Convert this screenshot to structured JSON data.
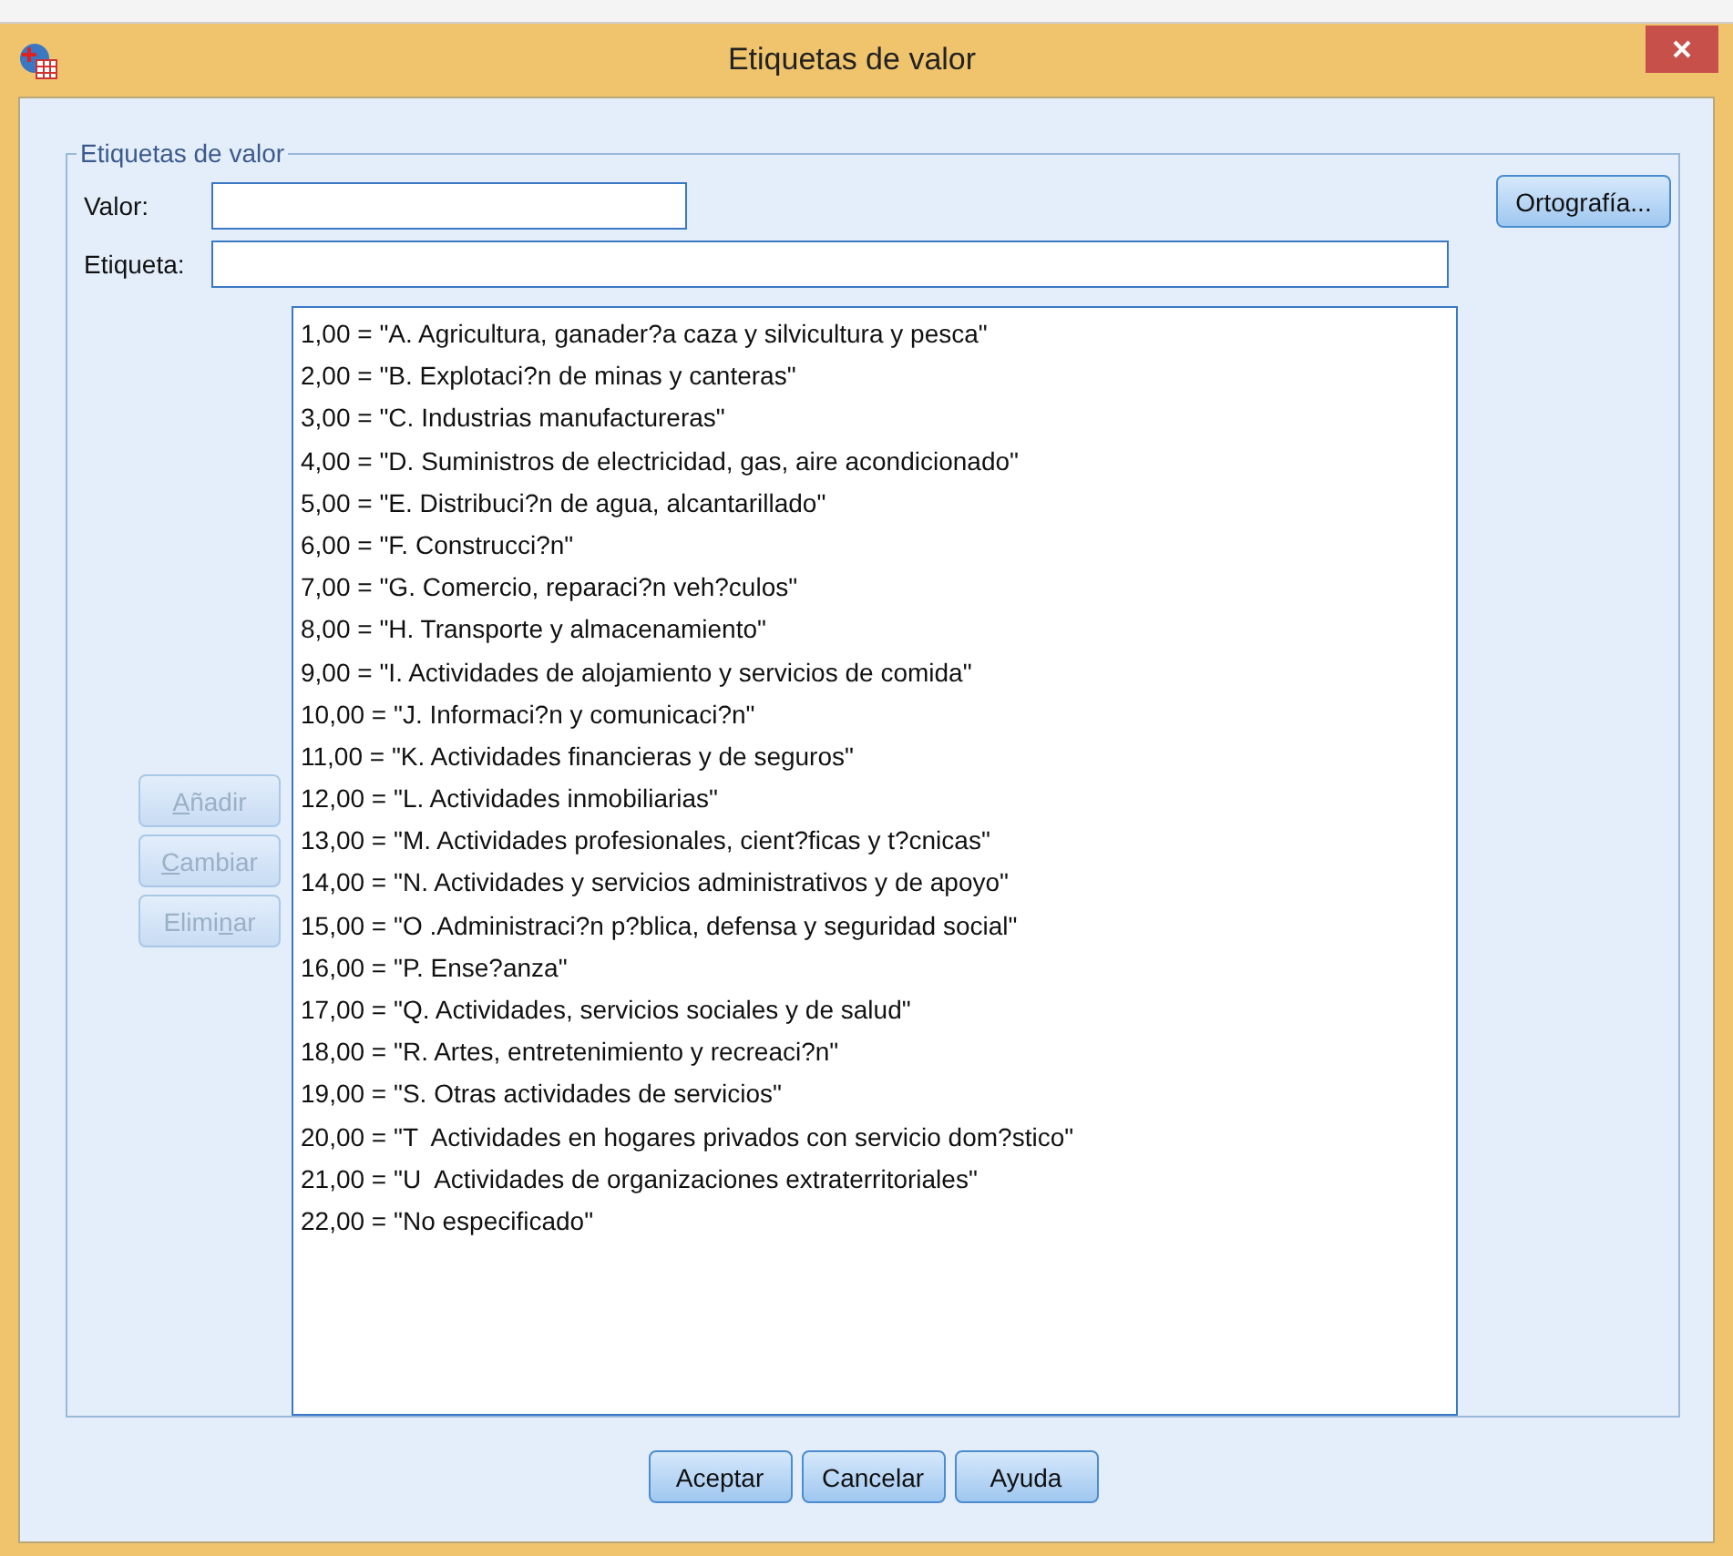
{
  "window": {
    "title": "Etiquetas de valor"
  },
  "group": {
    "legend": "Etiquetas de valor"
  },
  "fields": [
    {
      "label": "Valor:"
    },
    {
      "label": "Etiqueta:"
    }
  ],
  "spelling_button": {
    "label": "Ortografía...",
    "disabled": false
  },
  "side_buttons": [
    {
      "mnemonic": "A",
      "after": "ñadir",
      "disabled": true
    },
    {
      "mnemonic": "C",
      "after": "ambiar",
      "disabled": true
    },
    {
      "before": "Elimi",
      "mnemonic": "n",
      "after": "ar",
      "disabled": true
    }
  ],
  "labels_list": [
    {
      "text": "1,00 = \"A. Agricultura, ganader?a caza y silvicultura y pesca\""
    },
    {
      "text": "2,00 = \"B. Explotaci?n de minas y canteras\""
    },
    {
      "text": "3,00 = \"C. Industrias manufactureras\""
    },
    {
      "text": "4,00 = \"D. Suministros de electricidad, gas, aire acondicionado\""
    },
    {
      "text": "5,00 = \"E. Distribuci?n de agua, alcantarillado\""
    },
    {
      "text": "6,00 = \"F. Construcci?n\""
    },
    {
      "text": "7,00 = \"G. Comercio, reparaci?n veh?culos\""
    },
    {
      "text": "8,00 = \"H. Transporte y almacenamiento\""
    },
    {
      "text": "9,00 = \"I. Actividades de alojamiento y servicios de comida\""
    },
    {
      "text": "10,00 = \"J. Informaci?n y comunicaci?n\""
    },
    {
      "text": "11,00 = \"K. Actividades financieras y de seguros\""
    },
    {
      "text": "12,00 = \"L. Actividades inmobiliarias\""
    },
    {
      "text": "13,00 = \"M. Actividades profesionales, cient?ficas y t?cnicas\""
    },
    {
      "text": "14,00 = \"N. Actividades y servicios administrativos y de apoyo\""
    },
    {
      "text": "15,00 = \"O .Administraci?n p?blica, defensa y seguridad social\""
    },
    {
      "text": "16,00 = \"P. Ense?anza\""
    },
    {
      "text": "17,00 = \"Q. Actividades, servicios sociales y de salud\""
    },
    {
      "text": "18,00 = \"R. Artes, entretenimiento y recreaci?n\""
    },
    {
      "text": "19,00 = \"S. Otras actividades de servicios\""
    },
    {
      "text": "20,00 = \"T  Actividades en hogares privados con servicio dom?stico\""
    },
    {
      "text": "21,00 = \"U  Actividades de organizaciones extraterritoriales\""
    },
    {
      "text": "22,00 = \"No especificado\""
    }
  ],
  "footer_buttons": [
    {
      "label": "Aceptar"
    },
    {
      "label": "Cancelar"
    },
    {
      "label": "Ayuda"
    }
  ]
}
